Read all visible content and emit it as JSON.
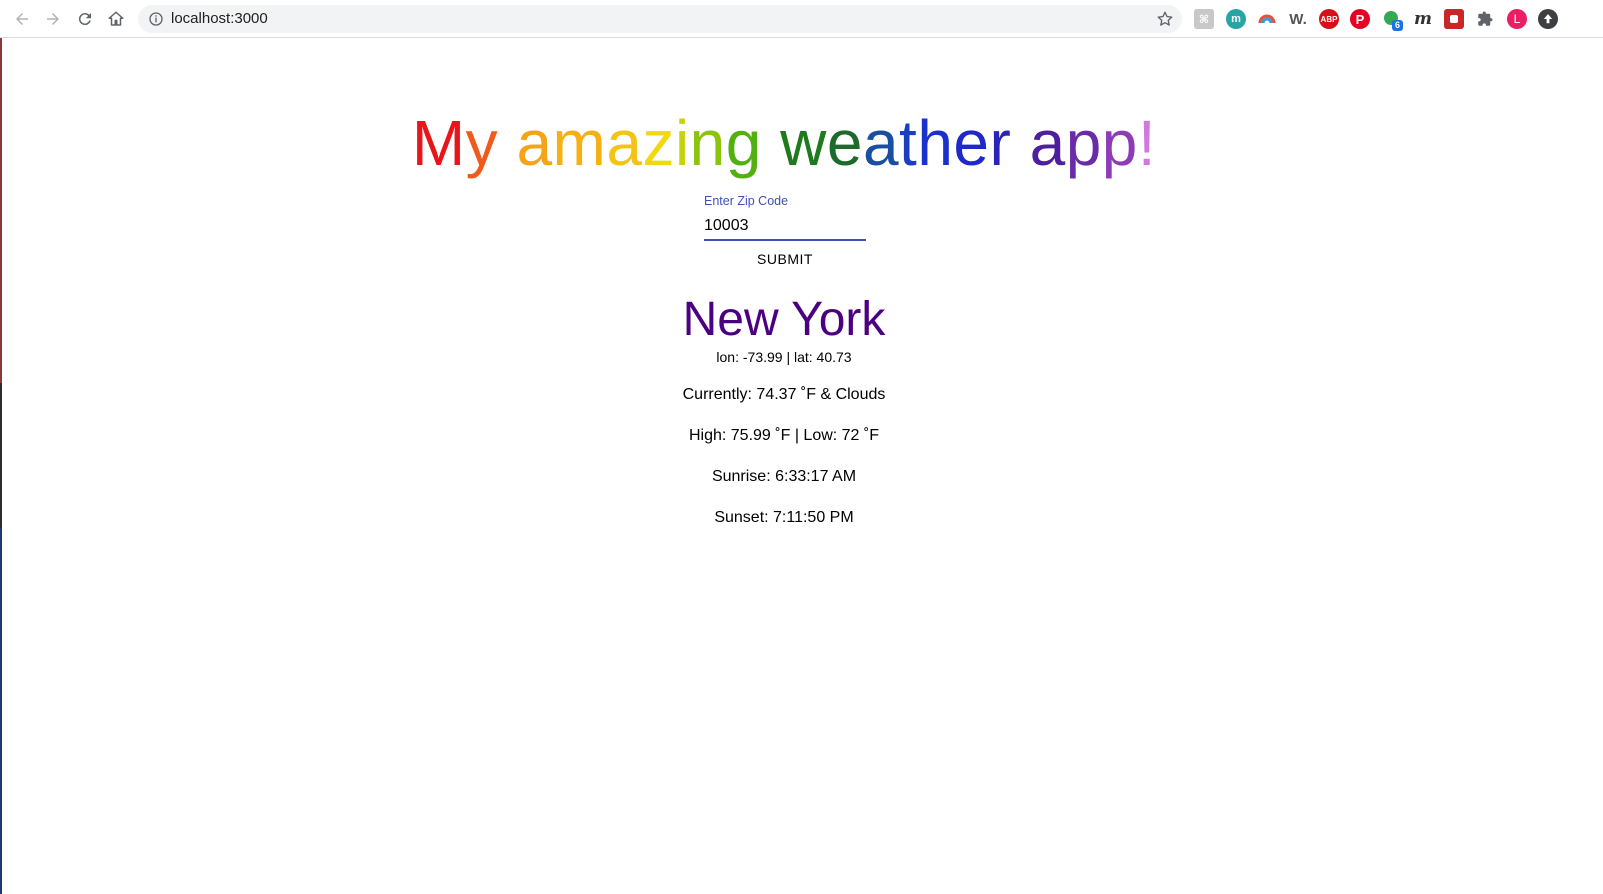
{
  "browser": {
    "url": "localhost:3000",
    "profile_initial": "L",
    "extension_badge": "6",
    "extensions": [
      "keyboard-shortcut-icon",
      "m-circle-icon",
      "rainbow-arc-icon",
      "w-icon",
      "adblock-icon",
      "pinterest-icon",
      "green-dot-icon",
      "m-italic-icon",
      "red-square-icon",
      "puzzle-icon"
    ]
  },
  "app": {
    "title_words": [
      "My",
      "amazing",
      "weather",
      "app!"
    ],
    "title_letters": [
      "M",
      "y",
      " ",
      "a",
      "m",
      "a",
      "z",
      "i",
      "n",
      "g",
      " ",
      "w",
      "e",
      "a",
      "t",
      "h",
      "e",
      "r",
      " ",
      "a",
      "p",
      "p",
      "!"
    ],
    "title_colors": [
      "#e8161a",
      "#f05a1c",
      "",
      "#f5a317",
      "#f6b015",
      "#f4c414",
      "#f2d80f",
      "#c6d10f",
      "#8bc30d",
      "#52b10e",
      "",
      "#1f7a1f",
      "#1d6b2a",
      "#194fa0",
      "#1a3fc0",
      "#1b31cc",
      "#1f28c9",
      "#2a24b8",
      "",
      "#4d1f9e",
      "#6b2aa8",
      "#8f3bb8",
      "#d377e0"
    ],
    "zip_label": "Enter Zip Code",
    "zip_value": "10003",
    "submit_label": "SUBMIT",
    "accent_color": "#3f51b5",
    "city_color": "#4b0082"
  },
  "weather": {
    "city": "New York",
    "coords": "lon: -73.99 | lat: 40.73",
    "currently": "Currently: 74.37 ˚F & Clouds",
    "high_low": "High: 75.99 ˚F | Low: 72 ˚F",
    "sunrise": "Sunrise: 6:33:17 AM",
    "sunset": "Sunset: 7:11:50 PM"
  }
}
